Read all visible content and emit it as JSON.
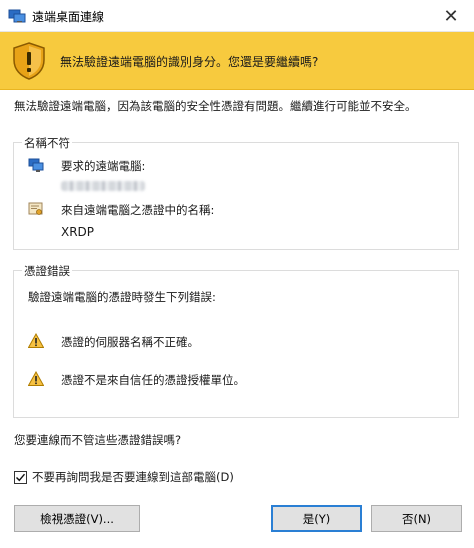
{
  "window": {
    "title": "遠端桌面連線",
    "close_glyph": "✕"
  },
  "banner": {
    "message": "無法驗證遠端電腦的識別身分。您還是要繼續嗎?",
    "color": "#f7ca3e"
  },
  "description": "無法驗證遠端電腦，因為該電腦的安全性憑證有問題。繼續進行可能並不安全。",
  "name_mismatch": {
    "legend": "名稱不符",
    "requested_label": "要求的遠端電腦:",
    "cert_label": "來自遠端電腦之憑證中的名稱:",
    "cert_name": "XRDP"
  },
  "cert_errors": {
    "legend": "憑證錯誤",
    "intro": "驗證遠端電腦的憑證時發生下列錯誤:",
    "errors": [
      "憑證的伺服器名稱不正確。",
      "憑證不是來自信任的憑證授權單位。"
    ]
  },
  "question": "您要連線而不管這些憑證錯誤嗎?",
  "dont_ask": {
    "label": "不要再詢問我是否要連線到這部電腦(D)",
    "checked": true
  },
  "buttons": {
    "view_cert": "檢視憑證(V)...",
    "yes": "是(Y)",
    "no": "否(N)"
  }
}
